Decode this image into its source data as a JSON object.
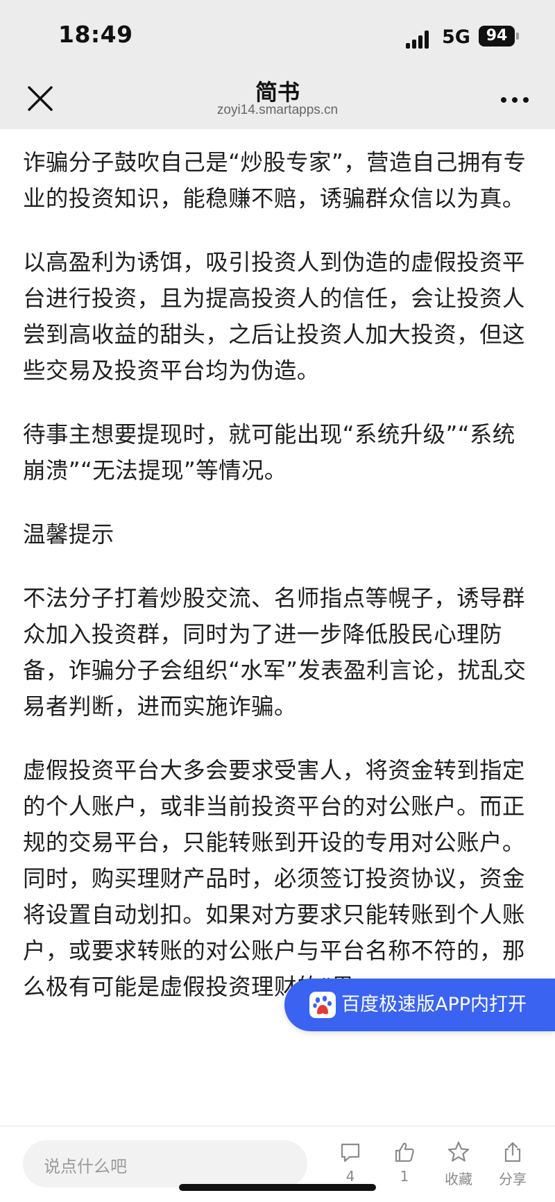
{
  "status_bar": {
    "time": "18:49",
    "network": "5G",
    "battery": "94"
  },
  "nav": {
    "title": "简书",
    "subtitle": "zoyi14.smartapps.cn"
  },
  "article": {
    "paragraphs": [
      "诈骗分子鼓吹自己是“炒股专家”，营造自己拥有专业的投资知识，能稳赚不赔，诱骗群众信以为真。",
      "以高盈利为诱饵，吸引投资人到伪造的虚假投资平台进行投资，且为提高投资人的信任，会让投资人尝到高收益的甜头，之后让投资人加大投资，但这些交易及投资平台均为伪造。",
      "待事主想要提现时，就可能出现“系统升级”“系统崩溃”“无法提现”等情况。",
      "温馨提示",
      "不法分子打着炒股交流、名师指点等幌子，诱导群众加入投资群，同时为了进一步降低股民心理防备，诈骗分子会组织“水军”发表盈利言论，扰乱交易者判断，进而实施诈骗。",
      "虚假投资平台大多会要求受害人，将资金转到指定的个人账户，或非当前投资平台的对公账户。而正规的交易平台，只能转账到开设的专用对公账户。同时，购买理财产品时，必须签订投资协议，资金将设置自动划扣。如果对方要求只能转账到个人账户，或要求转账的对公账户与平台名称不符的，那么极有可能是虚假投资理财的“黑"
    ]
  },
  "banner": {
    "label": "百度极速版APP内打开"
  },
  "bottom_bar": {
    "comment_placeholder": "说点什么吧",
    "comments_count": "4",
    "likes_count": "1",
    "favorite_label": "收藏",
    "share_label": "分享"
  },
  "icons": {
    "close": "close-icon",
    "more": "more-icon",
    "comment": "comment-icon",
    "like": "thumbs-up-icon",
    "favorite": "star-icon",
    "share": "share-icon",
    "baidu": "baidu-paw-icon"
  },
  "colors": {
    "banner_bg": "#3a63f2",
    "header_bg": "#ececec"
  }
}
